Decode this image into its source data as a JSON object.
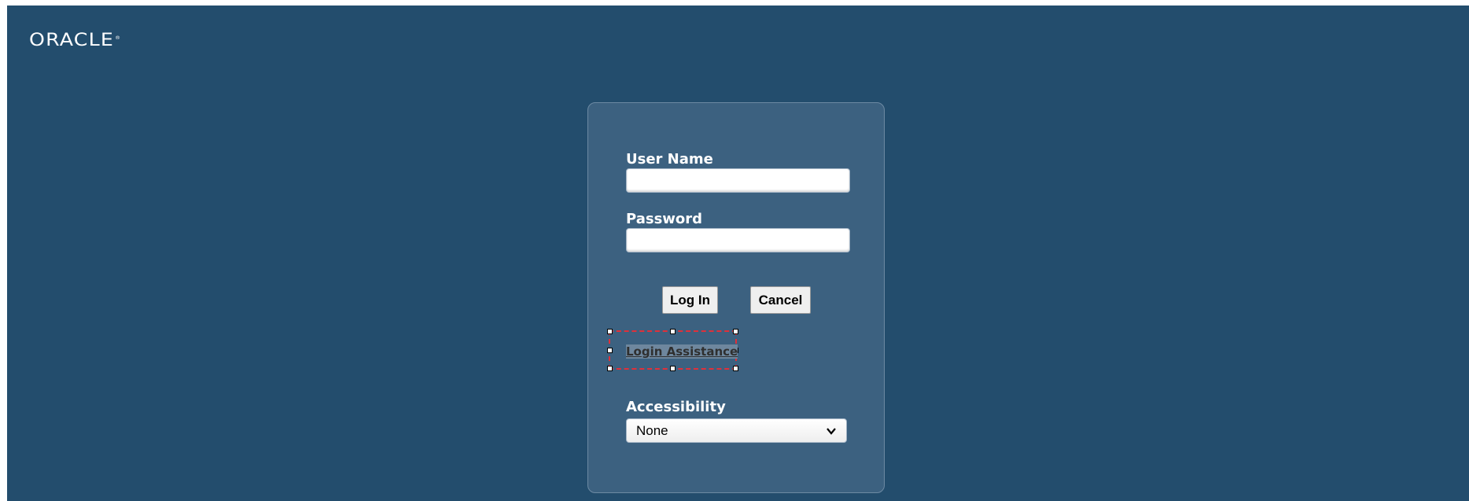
{
  "brand": {
    "logo_text": "ORACLE",
    "trademark": "®"
  },
  "login": {
    "username_label": "User Name",
    "username_value": "",
    "password_label": "Password",
    "password_value": "",
    "login_button": "Log In",
    "cancel_button": "Cancel",
    "assistance_link": "Login Assistance",
    "accessibility_label": "Accessibility",
    "accessibility_selected": "None"
  },
  "icons": {
    "dropdown": "chevron-down-icon"
  },
  "colors": {
    "background": "#234d6d",
    "panel": "#3c6180",
    "selection_frame": "#e0303a"
  }
}
